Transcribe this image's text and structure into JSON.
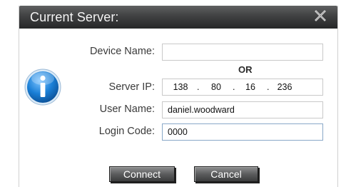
{
  "dialog": {
    "title": "Current Server:",
    "close_icon": "close-x-icon",
    "info_icon": "info-icon"
  },
  "form": {
    "device_name_label": "Device Name:",
    "device_name_value": "",
    "or_text": "OR",
    "server_ip_label": "Server IP:",
    "server_ip": {
      "octet1": "138",
      "octet2": "80",
      "octet3": "16",
      "octet4": "236",
      "separator": "."
    },
    "user_name_label": "User Name:",
    "user_name_value": "daniel.woodward",
    "login_code_label": "Login Code:",
    "login_code_value": "0000"
  },
  "buttons": {
    "connect": "Connect",
    "cancel": "Cancel"
  },
  "colors": {
    "titlebar": "#404142",
    "icon_blue": "#1a7fd6",
    "button": "#5b5c5d"
  }
}
